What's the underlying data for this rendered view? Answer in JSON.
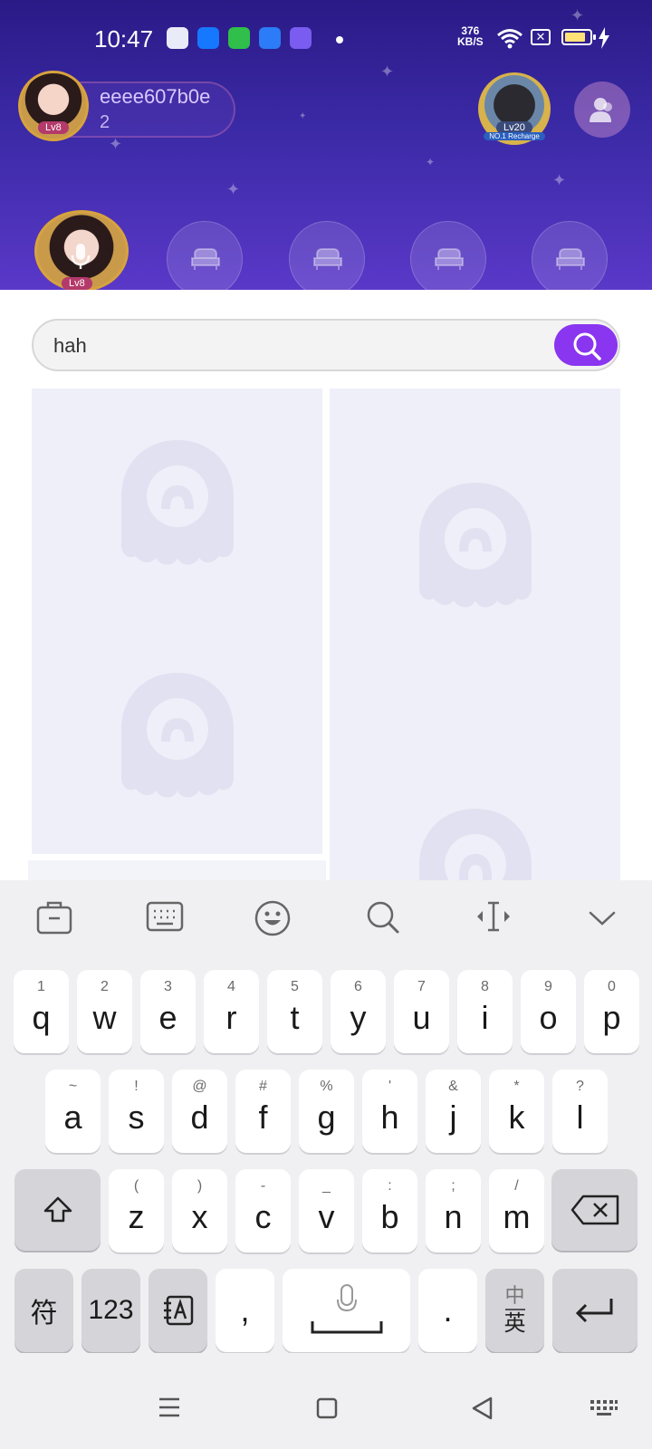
{
  "status_bar": {
    "time": "10:47",
    "net_speed_value": "376",
    "net_speed_unit": "KB/S",
    "battery_level": 0.85
  },
  "room": {
    "host_name": "eeee607b0e",
    "host_id": "2",
    "host_level": "Lv8",
    "rank_level": "Lv20",
    "rank_sub": "NO.1 Recharge",
    "seat_level": "Lv8"
  },
  "search": {
    "value": "hah"
  },
  "keyboard": {
    "row1": [
      {
        "sub": "1",
        "key": "q"
      },
      {
        "sub": "2",
        "key": "w"
      },
      {
        "sub": "3",
        "key": "e"
      },
      {
        "sub": "4",
        "key": "r"
      },
      {
        "sub": "5",
        "key": "t"
      },
      {
        "sub": "6",
        "key": "y"
      },
      {
        "sub": "7",
        "key": "u"
      },
      {
        "sub": "8",
        "key": "i"
      },
      {
        "sub": "9",
        "key": "o"
      },
      {
        "sub": "0",
        "key": "p"
      }
    ],
    "row2": [
      {
        "sub": "~",
        "key": "a"
      },
      {
        "sub": "!",
        "key": "s"
      },
      {
        "sub": "@",
        "key": "d"
      },
      {
        "sub": "#",
        "key": "f"
      },
      {
        "sub": "%",
        "key": "g"
      },
      {
        "sub": "'",
        "key": "h"
      },
      {
        "sub": "&",
        "key": "j"
      },
      {
        "sub": "*",
        "key": "k"
      },
      {
        "sub": "?",
        "key": "l"
      }
    ],
    "row3": [
      {
        "sub": "(",
        "key": "z"
      },
      {
        "sub": ")",
        "key": "x"
      },
      {
        "sub": "-",
        "key": "c"
      },
      {
        "sub": "_",
        "key": "v"
      },
      {
        "sub": ":",
        "key": "b"
      },
      {
        "sub": ";",
        "key": "n"
      },
      {
        "sub": "/",
        "key": "m"
      }
    ],
    "symbols_label": "符",
    "numbers_label": "123",
    "comma_label": ",",
    "period_label": ".",
    "lang_top": "中",
    "lang_bottom": "英"
  }
}
